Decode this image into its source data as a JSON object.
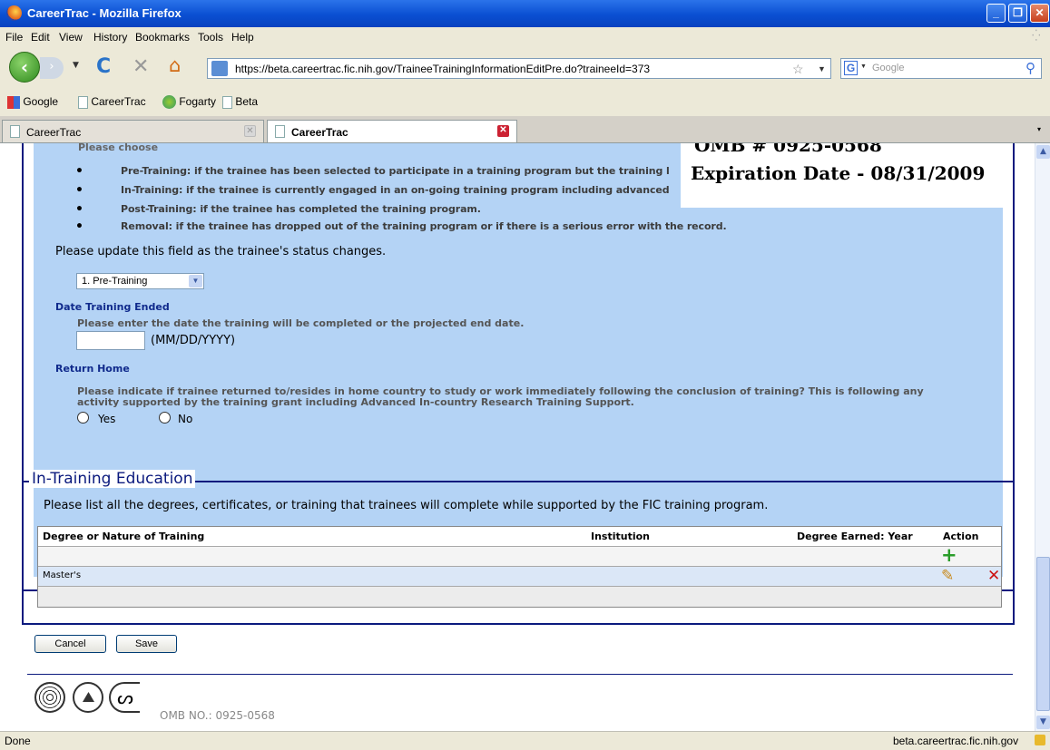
{
  "window": {
    "title": "CareerTrac - Mozilla Firefox"
  },
  "menu": [
    "File",
    "Edit",
    "View",
    "History",
    "Bookmarks",
    "Tools",
    "Help"
  ],
  "nav": {
    "url": "https://beta.careertrac.fic.nih.gov/TraineeTrainingInformationEditPre.do?traineeId=373",
    "search_placeholder": "Google"
  },
  "bookmarks": [
    "Google",
    "CareerTrac",
    "Fogarty",
    "Beta"
  ],
  "tabs": [
    {
      "label": "CareerTrac",
      "active": false
    },
    {
      "label": "CareerTrac",
      "active": true
    }
  ],
  "omb_box": {
    "line1": "OMB # 0925-0568",
    "line2": "Expiration Date - 08/31/2009"
  },
  "status_section": {
    "partial_label": "Please choose",
    "bullets": [
      "Pre-Training: if the trainee has been selected to participate in a training program but the training l",
      "In-Training: if the trainee is currently engaged in an on-going training program including advanced",
      "Post-Training: if the trainee has completed the training program.",
      "Removal: if the trainee has dropped out of the training program or if there is a serious error with the record."
    ],
    "update_note": "Please update this field as the trainee's status changes.",
    "selected_status": "1. Pre-Training"
  },
  "date_ended": {
    "label": "Date Training Ended",
    "help": "Please enter the date the training will be completed or the projected end date.",
    "format": "(MM/DD/YYYY)",
    "value": ""
  },
  "return_home": {
    "label": "Return Home",
    "help_line1": "Please indicate if trainee returned to/resides in home country to study or work immediately following the conclusion of training? This is following any",
    "help_line2": "activity supported by the training grant including Advanced In-country Research Training Support.",
    "yes": "Yes",
    "no": "No"
  },
  "education": {
    "legend": "In-Training Education",
    "intro": "Please list all the degrees, certificates, or training that trainees will complete while supported by the FIC training program.",
    "columns": [
      "Degree or Nature of Training",
      "Institution",
      "Degree Earned: Year",
      "Action"
    ],
    "rows": [
      {
        "degree": "Master's",
        "institution": "",
        "year": ""
      }
    ]
  },
  "buttons": {
    "cancel": "Cancel",
    "save": "Save"
  },
  "footer": {
    "omb": "OMB NO.: 0925-0568"
  },
  "statusbar": {
    "left": "Done",
    "right": "beta.careertrac.fic.nih.gov"
  },
  "colors": {
    "panel_blue": "#b4d3f5",
    "border_navy": "#0b1a7e",
    "add_green": "#2a9d2a",
    "delete_red": "#cc1111"
  }
}
